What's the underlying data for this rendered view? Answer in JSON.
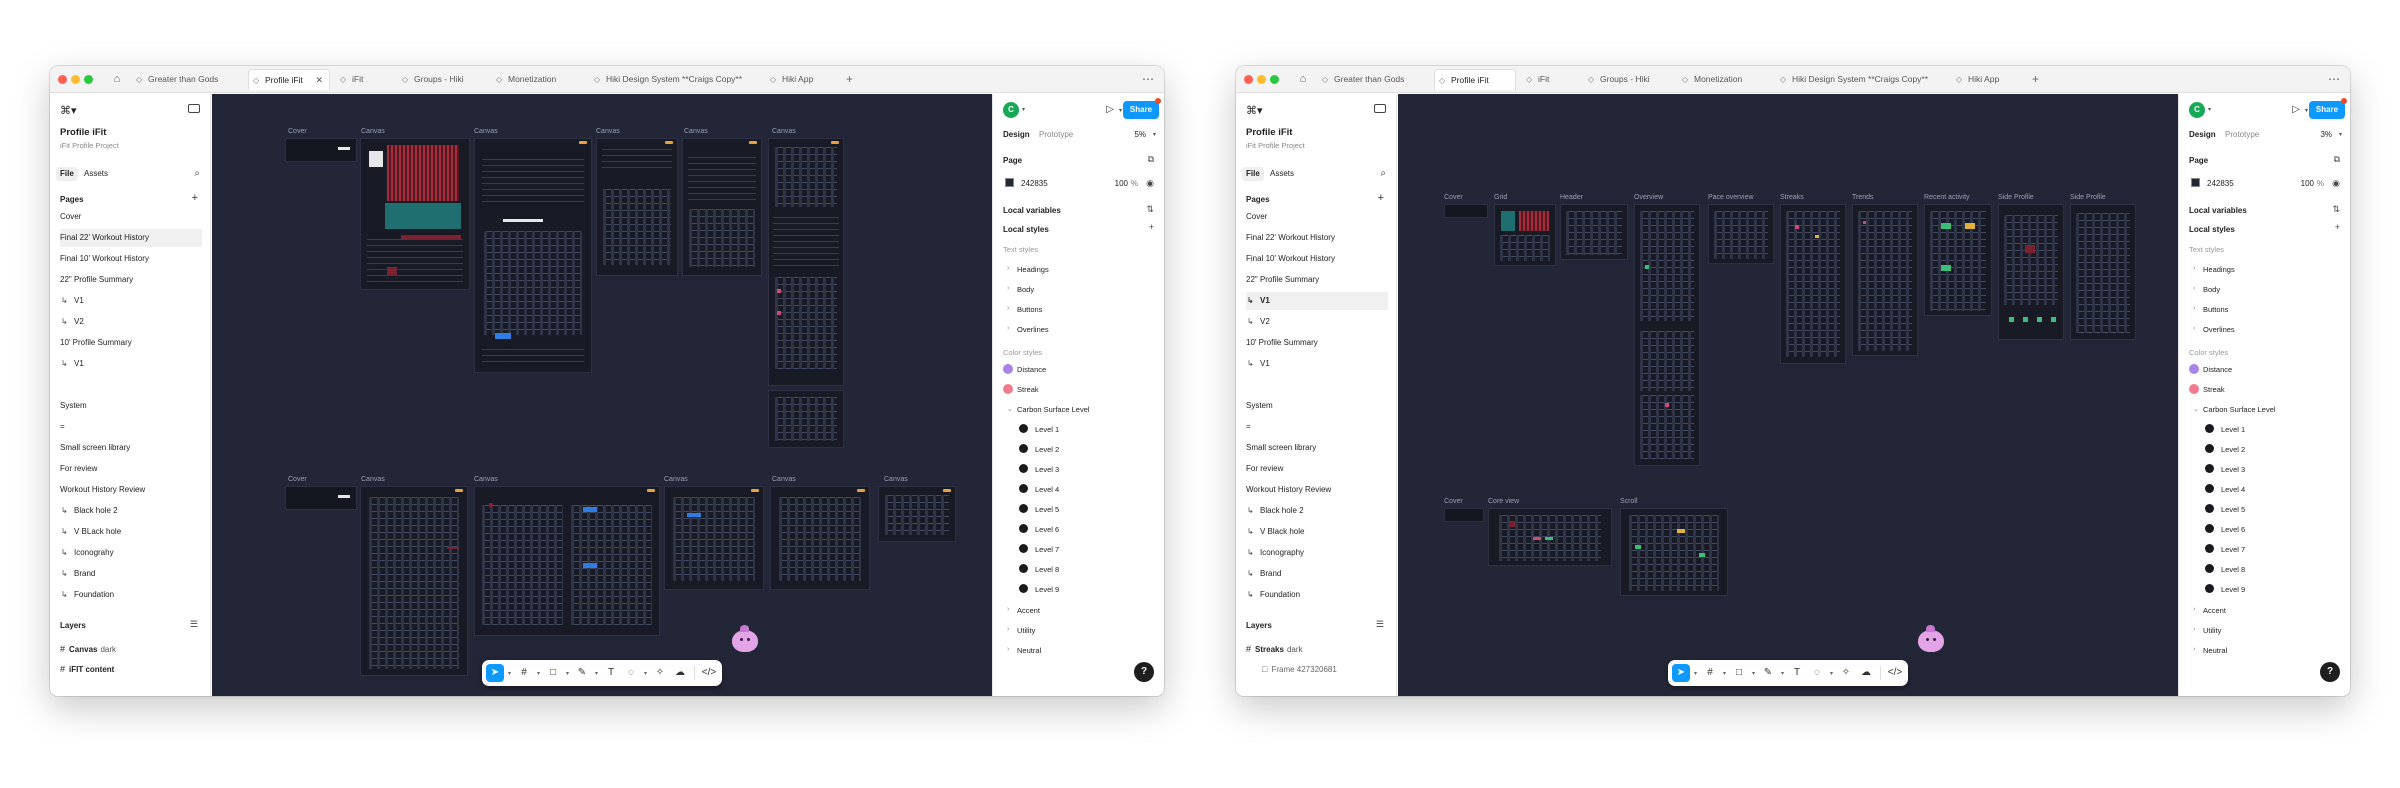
{
  "tabs": [
    "Greater than Gods",
    "Profile iFit",
    "iFit",
    "Groups - Hiki",
    "Monetization",
    "Hiki Design System **Craigs Copy**",
    "Hiki App"
  ],
  "left_panel": {
    "project_name": "Profile iFit",
    "project_sub": "iFit Profile Project",
    "file_tab": "File",
    "assets_tab": "Assets",
    "pages_header": "Pages",
    "pages": [
      "Cover",
      "Final 22' Workout History",
      "Final 10' Workout History",
      "22\" Profile Summary",
      "V1",
      "V2",
      "10' Profile Summary",
      "V1",
      "System",
      "=",
      "Small screen library",
      "For review",
      "Workout History Review",
      "Black hole 2",
      "V BLack hole",
      "Iconograhy",
      "Brand",
      "Foundation"
    ],
    "pages_w2": [
      "Cover",
      "Final 22' Workout History",
      "Final 10' Workout History",
      "22\" Profile Summary",
      "V1",
      "V2",
      "10' Profile Summary",
      "V1",
      "System",
      "=",
      "Small screen library",
      "For review",
      "Workout History Review",
      "Black hole 2",
      "V Black hole",
      "Iconography",
      "Brand",
      "Foundation"
    ],
    "layers_header": "Layers",
    "w1_layer1_name": "Canvas",
    "w1_layer1_tag": "dark",
    "w1_layer2_name": "iFIT content",
    "w2_layer1_name": "Streaks",
    "w2_layer1_tag": "dark",
    "w2_layer2_name": "Frame 427320681"
  },
  "right_panel": {
    "avatar": "C",
    "share": "Share",
    "design_tab": "Design",
    "prototype_tab": "Prototype",
    "zoom_w1": "5%",
    "zoom_w2": "3%",
    "page_header": "Page",
    "page_color": "242835",
    "page_opacity": "100",
    "page_pct": "%",
    "local_variables": "Local variables",
    "local_styles": "Local styles",
    "text_styles": "Text styles",
    "text_style_items": [
      "Headings",
      "Body",
      "Buttons",
      "Overlines"
    ],
    "color_styles": "Color styles",
    "distance": "Distance",
    "streak": "Streak",
    "carbon": "Carbon Surface Level",
    "levels": [
      "Level 1",
      "Level 2",
      "Level 3",
      "Level 4",
      "Level 5",
      "Level 6",
      "Level 7",
      "Level 8",
      "Level 9"
    ],
    "accent": "Accent",
    "utility": "Utility",
    "neutral": "Neutral"
  },
  "canvas1": {
    "labels_top": [
      "Cover",
      "Canvas",
      "Canvas",
      "Canvas",
      "Canvas",
      "Canvas"
    ],
    "labels_bottom": [
      "Cover",
      "Canvas",
      "Canvas",
      "Canvas",
      "Canvas",
      "Canvas"
    ],
    "background": "#242835"
  },
  "canvas2": {
    "labels_top": [
      "Cover",
      "Grid",
      "Header",
      "Overview",
      "Pace overview",
      "Streaks",
      "Trends",
      "Recent activity",
      "Side Profile",
      "Side Profile"
    ],
    "labels_bottom": [
      "Cover",
      "Core view",
      "Scroll"
    ]
  },
  "colors": {
    "accent": "#0d99ff",
    "distance": "#a883e8",
    "streak": "#f07b8d",
    "canvas": "#242835"
  },
  "help": "?"
}
